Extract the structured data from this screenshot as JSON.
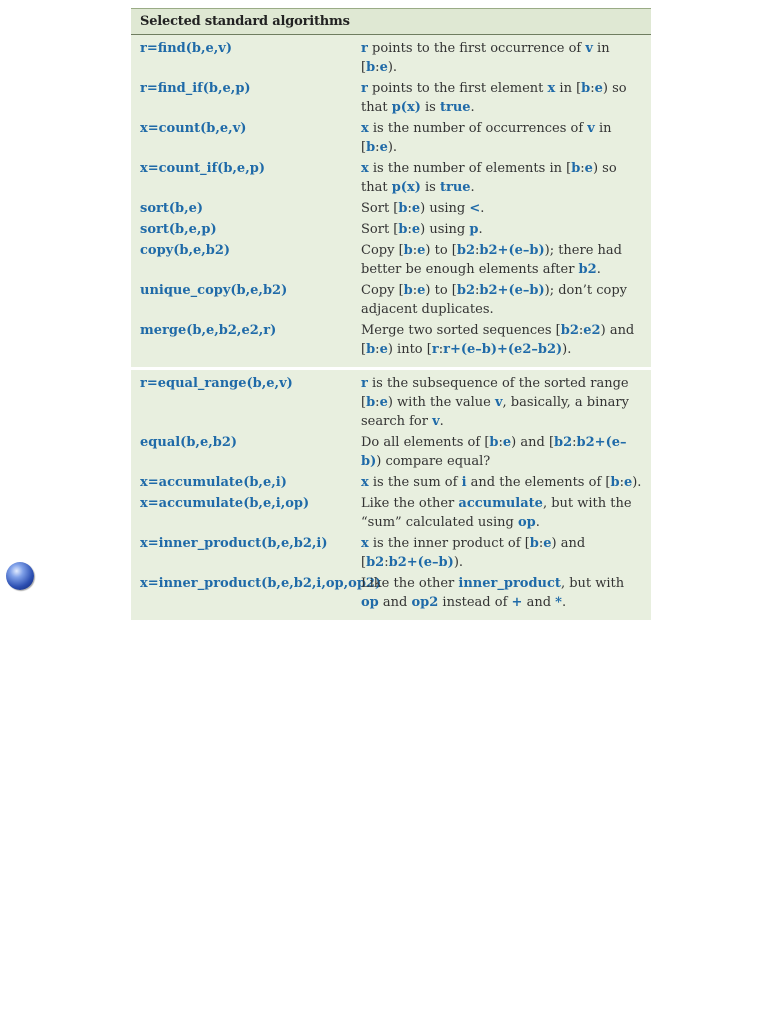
{
  "table": {
    "title": "Selected standard algorithms",
    "sections": [
      {
        "rows": [
          {
            "signature": "r=find(b,e,v)",
            "description": [
              {
                "t": "r",
                "code": true
              },
              {
                "t": " points to the first occurrence of "
              },
              {
                "t": "v",
                "code": true
              },
              {
                "t": " in ["
              },
              {
                "t": "b",
                "code": true
              },
              {
                "t": ":"
              },
              {
                "t": "e",
                "code": true
              },
              {
                "t": ")."
              }
            ]
          },
          {
            "signature": "r=find_if(b,e,p)",
            "description": [
              {
                "t": "r",
                "code": true
              },
              {
                "t": " points to the first element "
              },
              {
                "t": "x",
                "code": true
              },
              {
                "t": " in ["
              },
              {
                "t": "b",
                "code": true
              },
              {
                "t": ":"
              },
              {
                "t": "e",
                "code": true
              },
              {
                "t": ") so that "
              },
              {
                "t": "p(x)",
                "code": true
              },
              {
                "t": " is "
              },
              {
                "t": "true",
                "code": true
              },
              {
                "t": "."
              }
            ]
          },
          {
            "signature": "x=count(b,e,v)",
            "description": [
              {
                "t": "x",
                "code": true
              },
              {
                "t": " is the number of occurrences of "
              },
              {
                "t": "v",
                "code": true
              },
              {
                "t": " in ["
              },
              {
                "t": "b",
                "code": true
              },
              {
                "t": ":"
              },
              {
                "t": "e",
                "code": true
              },
              {
                "t": ")."
              }
            ]
          },
          {
            "signature": "x=count_if(b,e,p)",
            "description": [
              {
                "t": "x",
                "code": true
              },
              {
                "t": " is the number of elements in ["
              },
              {
                "t": "b",
                "code": true
              },
              {
                "t": ":"
              },
              {
                "t": "e",
                "code": true
              },
              {
                "t": ") so that "
              },
              {
                "t": "p(x)",
                "code": true
              },
              {
                "t": " is "
              },
              {
                "t": "true",
                "code": true
              },
              {
                "t": "."
              }
            ]
          },
          {
            "signature": "sort(b,e)",
            "description": [
              {
                "t": "Sort ["
              },
              {
                "t": "b",
                "code": true
              },
              {
                "t": ":"
              },
              {
                "t": "e",
                "code": true
              },
              {
                "t": ") using "
              },
              {
                "t": "<",
                "code": true
              },
              {
                "t": "."
              }
            ]
          },
          {
            "signature": "sort(b,e,p)",
            "description": [
              {
                "t": "Sort ["
              },
              {
                "t": "b",
                "code": true
              },
              {
                "t": ":"
              },
              {
                "t": "e",
                "code": true
              },
              {
                "t": ") using "
              },
              {
                "t": "p",
                "code": true
              },
              {
                "t": "."
              }
            ]
          },
          {
            "signature": "copy(b,e,b2)",
            "description": [
              {
                "t": "Copy ["
              },
              {
                "t": "b",
                "code": true
              },
              {
                "t": ":"
              },
              {
                "t": "e",
                "code": true
              },
              {
                "t": ") to ["
              },
              {
                "t": "b2",
                "code": true
              },
              {
                "t": ":"
              },
              {
                "t": "b2+(e–b)",
                "code": true
              },
              {
                "t": "); there had better be enough elements after "
              },
              {
                "t": "b2",
                "code": true
              },
              {
                "t": "."
              }
            ]
          },
          {
            "signature": "unique_copy(b,e,b2)",
            "description": [
              {
                "t": "Copy ["
              },
              {
                "t": "b",
                "code": true
              },
              {
                "t": ":"
              },
              {
                "t": "e",
                "code": true
              },
              {
                "t": ") to ["
              },
              {
                "t": "b2",
                "code": true
              },
              {
                "t": ":"
              },
              {
                "t": "b2+(e–b)",
                "code": true
              },
              {
                "t": "); don’t copy adjacent duplicates."
              }
            ]
          },
          {
            "signature": "merge(b,e,b2,e2,r)",
            "description": [
              {
                "t": "Merge two sorted sequences ["
              },
              {
                "t": "b2",
                "code": true
              },
              {
                "t": ":"
              },
              {
                "t": "e2",
                "code": true
              },
              {
                "t": ") and ["
              },
              {
                "t": "b",
                "code": true
              },
              {
                "t": ":"
              },
              {
                "t": "e",
                "code": true
              },
              {
                "t": ") into ["
              },
              {
                "t": "r",
                "code": true
              },
              {
                "t": ":"
              },
              {
                "t": "r+(e–b)+(e2–b2)",
                "code": true
              },
              {
                "t": ")."
              }
            ]
          }
        ]
      },
      {
        "rows": [
          {
            "signature": "r=equal_range(b,e,v)",
            "description": [
              {
                "t": "r",
                "code": true
              },
              {
                "t": " is the subsequence of the sorted range ["
              },
              {
                "t": "b",
                "code": true
              },
              {
                "t": ":"
              },
              {
                "t": "e",
                "code": true
              },
              {
                "t": ") with the value "
              },
              {
                "t": "v",
                "code": true
              },
              {
                "t": ", basically, a binary search for "
              },
              {
                "t": "v",
                "code": true
              },
              {
                "t": "."
              }
            ]
          },
          {
            "signature": "equal(b,e,b2)",
            "description": [
              {
                "t": "Do all elements of ["
              },
              {
                "t": "b",
                "code": true
              },
              {
                "t": ":"
              },
              {
                "t": "e",
                "code": true
              },
              {
                "t": ") and ["
              },
              {
                "t": "b2",
                "code": true
              },
              {
                "t": ":"
              },
              {
                "t": "b2+(e–b)",
                "code": true
              },
              {
                "t": ") compare equal?"
              }
            ]
          },
          {
            "signature": "x=accumulate(b,e,i)",
            "description": [
              {
                "t": "x",
                "code": true
              },
              {
                "t": " is the sum of "
              },
              {
                "t": "i",
                "code": true
              },
              {
                "t": " and the elements of ["
              },
              {
                "t": "b",
                "code": true
              },
              {
                "t": ":"
              },
              {
                "t": "e",
                "code": true
              },
              {
                "t": ")."
              }
            ]
          },
          {
            "signature": "x=accumulate(b,e,i,op)",
            "description": [
              {
                "t": "Like the other "
              },
              {
                "t": "accumulate",
                "code": true
              },
              {
                "t": ", but with the “sum” calculated using "
              },
              {
                "t": "op",
                "code": true
              },
              {
                "t": "."
              }
            ]
          },
          {
            "signature": "x=inner_product(b,e,b2,i)",
            "description": [
              {
                "t": "x",
                "code": true
              },
              {
                "t": " is the inner product of ["
              },
              {
                "t": "b",
                "code": true
              },
              {
                "t": ":"
              },
              {
                "t": "e",
                "code": true
              },
              {
                "t": ") and ["
              },
              {
                "t": "b2",
                "code": true
              },
              {
                "t": ":"
              },
              {
                "t": "b2+(e–b)",
                "code": true
              },
              {
                "t": ")."
              }
            ]
          },
          {
            "signature": "x=inner_product(b,e,b2,i,op,op2)",
            "description": [
              {
                "t": "Like the other "
              },
              {
                "t": "inner_product",
                "code": true
              },
              {
                "t": ", but with "
              },
              {
                "t": "op",
                "code": true
              },
              {
                "t": " and "
              },
              {
                "t": "op2",
                "code": true
              },
              {
                "t": " instead of "
              },
              {
                "t": "+",
                "code": true
              },
              {
                "t": " and "
              },
              {
                "t": "*",
                "code": true
              },
              {
                "t": "."
              }
            ]
          }
        ]
      }
    ]
  },
  "decorations": {
    "margin_bullet_icon": "blue-sphere-icon"
  },
  "colors": {
    "code_text": "#1f6aa8",
    "body_text": "#333333",
    "table_background": "#e8efdf",
    "header_background": "#dfe8d3"
  }
}
